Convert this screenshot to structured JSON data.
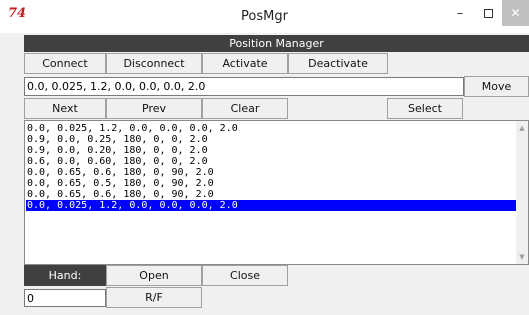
{
  "window": {
    "title": "PosMgr",
    "app_icon": "74",
    "minimize": "–",
    "close": "✕"
  },
  "header": {
    "title": "Position Manager"
  },
  "toolbar": {
    "connect": "Connect",
    "disconnect": "Disconnect",
    "activate": "Activate",
    "deactivate": "Deactivate"
  },
  "position_entry": {
    "value": "0.0, 0.025, 1.2, 0.0, 0.0, 0.0, 2.0"
  },
  "move_button": "Move",
  "nav": {
    "next": "Next",
    "prev": "Prev",
    "clear": "Clear",
    "select": "Select"
  },
  "positions": [
    "0.0, 0.025, 1.2, 0.0, 0.0, 0.0, 2.0",
    "0.9, 0.0, 0.25, 180, 0, 0, 2.0",
    "0.9, 0.0, 0.20, 180, 0, 0, 2.0",
    "0.6, 0.0, 0.60, 180, 0, 0, 2.0",
    "0.0, 0.65, 0.6, 180, 0, 90, 2.0",
    "0.0, 0.65, 0.5, 180, 0, 90, 2.0",
    "0.0, 0.65, 0.6, 180, 0, 90, 2.0",
    "0.0, 0.025, 1.2, 0.0, 0.0, 0.0, 2.0"
  ],
  "selected_index": 7,
  "hand": {
    "label": "Hand:",
    "open": "Open",
    "close": "Close",
    "value": "0",
    "rf": "R/F"
  },
  "colors": {
    "header_bg": "#404040",
    "selection_bg": "#0000ff",
    "icon_red": "#cc1a1a"
  }
}
